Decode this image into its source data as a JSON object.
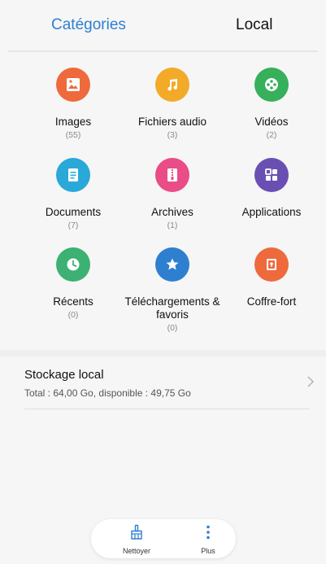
{
  "tabs": {
    "categories": "Catégories",
    "local": "Local"
  },
  "categories": [
    {
      "label": "Images",
      "count": "(55)",
      "icon": "image-icon",
      "color": "#ee6a3c"
    },
    {
      "label": "Fichiers audio",
      "count": "(3)",
      "icon": "music-note-icon",
      "color": "#f3aa28"
    },
    {
      "label": "Vidéos",
      "count": "(2)",
      "icon": "film-reel-icon",
      "color": "#36b05a"
    },
    {
      "label": "Documents",
      "count": "(7)",
      "icon": "document-icon",
      "color": "#2aa8d8"
    },
    {
      "label": "Archives",
      "count": "(1)",
      "icon": "archive-zip-icon",
      "color": "#e94c86"
    },
    {
      "label": "Applications",
      "count": "",
      "icon": "apps-grid-icon",
      "color": "#6a4fb3"
    },
    {
      "label": "Récents",
      "count": "(0)",
      "icon": "clock-icon",
      "color": "#3cb173"
    },
    {
      "label": "Téléchargements & favoris",
      "count": "(0)",
      "icon": "star-icon",
      "color": "#2f7fd0"
    },
    {
      "label": "Coffre-fort",
      "count": "",
      "icon": "safe-icon",
      "color": "#ee6a3c"
    }
  ],
  "storage": {
    "title": "Stockage local",
    "subtitle": "Total : 64,00  Go, disponible : 49,75  Go"
  },
  "bottom_bar": {
    "clean_label": "Nettoyer",
    "more_label": "Plus"
  }
}
